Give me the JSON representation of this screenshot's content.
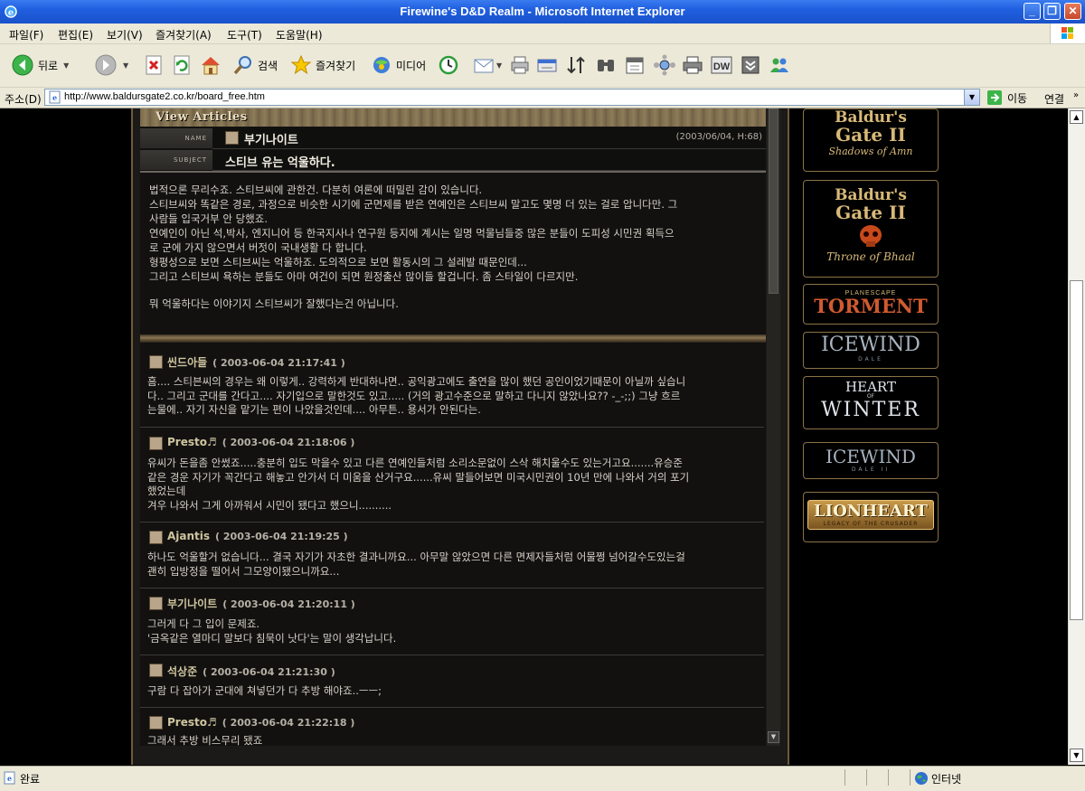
{
  "window": {
    "title": "Firewine's D&D Realm - Microsoft Internet Explorer",
    "minimize_glyph": "_",
    "maximize_glyph": "❐",
    "close_glyph": "✕"
  },
  "menu": [
    "파일(F)",
    "편집(E)",
    "보기(V)",
    "즐겨찾기(A)",
    "도구(T)",
    "도움말(H)"
  ],
  "toolbar": {
    "back_label": "뒤로",
    "search_label": "검색",
    "favorites_label": "즐겨찾기",
    "media_label": "미디어",
    "tool_dw_label": "DW"
  },
  "address": {
    "label": "주소(D)",
    "url": "http://www.baldursgate2.co.kr/board_free.htm",
    "go_label": "이동",
    "links_label": "연결"
  },
  "article": {
    "header": "View Articles",
    "name_label": "NAME",
    "subject_label": "SUBJECT",
    "author": "부기나이트",
    "date": "(2003/06/04, H:68)",
    "subject": "스티브 유는 억울하다.",
    "body": [
      "법적으론 무리수죠. 스티브씨에 관한건. 다분히 여론에 떠밀린 감이 있습니다.",
      "스티브씨와 똑같은 경로, 과정으로 비슷한 시기에 군면제를 받은 연예인은 스티브씨 말고도 몇명 더 있는 걸로 압니다만. 그",
      "사람들 입국거부 안 당했죠.",
      "연예인이 아닌 석,박사, 엔지니어 등  한국지사나 연구원 등지에 계시는 일명 먹물님들중 많은 분들이 도피성 시민권 획득으",
      "로 군에 가지 않으면서 버젓이 국내생활 다 합니다.",
      "형평성으로 보면 스티브씨는 억울하죠. 도의적으로 보면 활동시의 그 설레발 때문인데...",
      "그리고 스티브씨 욕하는 분들도 아마 여건이 되면 원정출산 많이들 할겁니다. 좀 스타일이 다르지만.",
      "",
      "뭐 억울하다는 이야기지 스티브씨가 잘했다는건 아닙니다."
    ]
  },
  "comments": [
    {
      "name": "씬드아들",
      "date": "( 2003-06-04 21:17:41 )",
      "lines": [
        "흠.... 스티븐씨의 경우는 왜 이렇게.. 강력하게 반대하냐면.. 공익광고에도 출연을 많이 했던 공인이었기때문이 아닐까 싶습니",
        "다.. 그리고 군대를 간다고.... 자기입으로 말한것도 있고..... (거의 광고수준으로 말하고 다니지 않았나요?? -_-;;) 그냥 흐르",
        "는물에.. 자기 자신을 맡기는 편이 나았을것인데.... 아무튼.. 용서가 안된다는."
      ]
    },
    {
      "name": "Presto♬",
      "date": "( 2003-06-04 21:18:06 )",
      "lines": [
        "유씨가 돈을좀 안썼죠.....충분히 입도 막을수 있고 다른 연예인들처럼 소리소문없이 스삭 해치울수도 있는거고요.......유승준",
        "같은 경운 자기가 꼭간다고 해놓고 안가서 더 미움을 산거구요......유씨 말들어보면 미국시민권이 10년 만에 나와서 거의 포기",
        "했었는데",
        "겨우 나와서 그게 아까워서 시민이 됐다고 했으니.........."
      ]
    },
    {
      "name": "Ajantis",
      "date": "( 2003-06-04 21:19:25 )",
      "lines": [
        "하나도 억울할거 없습니다... 결국 자기가 자초한 결과니까요... 아무말 않았으면 다른 면제자들처럼 어물쩡 넘어갈수도있는걸",
        "괜히 입방정을 떨어서 그모양이됐으니까요..."
      ]
    },
    {
      "name": "부기나이트",
      "date": "( 2003-06-04 21:20:11 )",
      "lines": [
        "그러게 다 그 입이 문제죠.",
        "'금옥같은 열마디 말보다 침묵이 낫다'는 말이 생각납니다."
      ]
    },
    {
      "name": "석상준",
      "date": "( 2003-06-04 21:21:30 )",
      "lines": [
        "구람 다 잡아가 군대에 쳐넣던가 다 추방 해야죠..ㅡㅡ;"
      ]
    },
    {
      "name": "Presto♬",
      "date": "( 2003-06-04 21:22:18 )",
      "lines": [
        "그래서 추방 비스무리 됐죠"
      ]
    }
  ],
  "games": [
    {
      "line1": "Baldur's",
      "line2": "Gate II",
      "line3": "Shadows of Amn"
    },
    {
      "line1": "Baldur's",
      "line2": "Gate II",
      "line3": "Throne of Bhaal"
    },
    {
      "line1": "PLANESCAPE",
      "line2": "TORMENT"
    },
    {
      "line1": "ICEWIND",
      "line2": "DALE"
    },
    {
      "line1": "HEART",
      "line2": "WINTER",
      "line3": "OF"
    },
    {
      "line1": "ICEWIND",
      "line2": "DALE II"
    },
    {
      "line1": "LIONHEART",
      "line2": "LEGACY OF THE CRUSADER"
    }
  ],
  "status": {
    "text": "완료",
    "zone": "인터넷"
  }
}
